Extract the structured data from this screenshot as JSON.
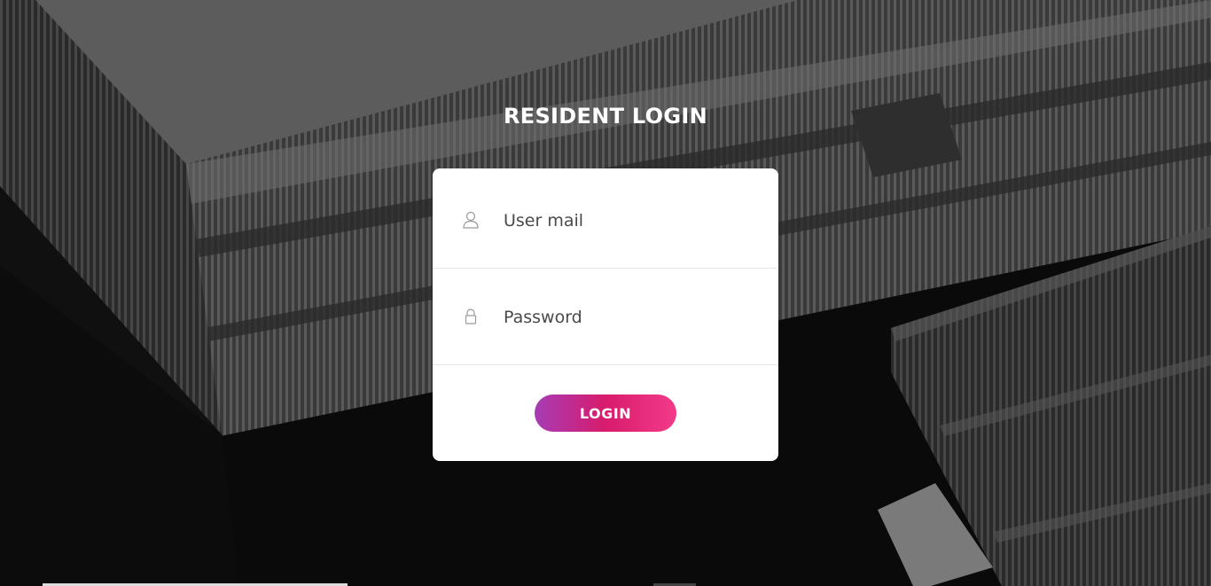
{
  "page": {
    "title": "RESIDENT LOGIN"
  },
  "form": {
    "email": {
      "placeholder": "User mail",
      "value": "",
      "icon": "user-icon"
    },
    "password": {
      "placeholder": "Password",
      "value": "",
      "icon": "lock-icon"
    },
    "submit_label": "LOGIN"
  },
  "colors": {
    "button_gradient_start": "#a63cb5",
    "button_gradient_mid": "#d81b6c",
    "button_gradient_end": "#f33b8a",
    "card_background": "#ffffff",
    "title_color": "#ffffff"
  }
}
